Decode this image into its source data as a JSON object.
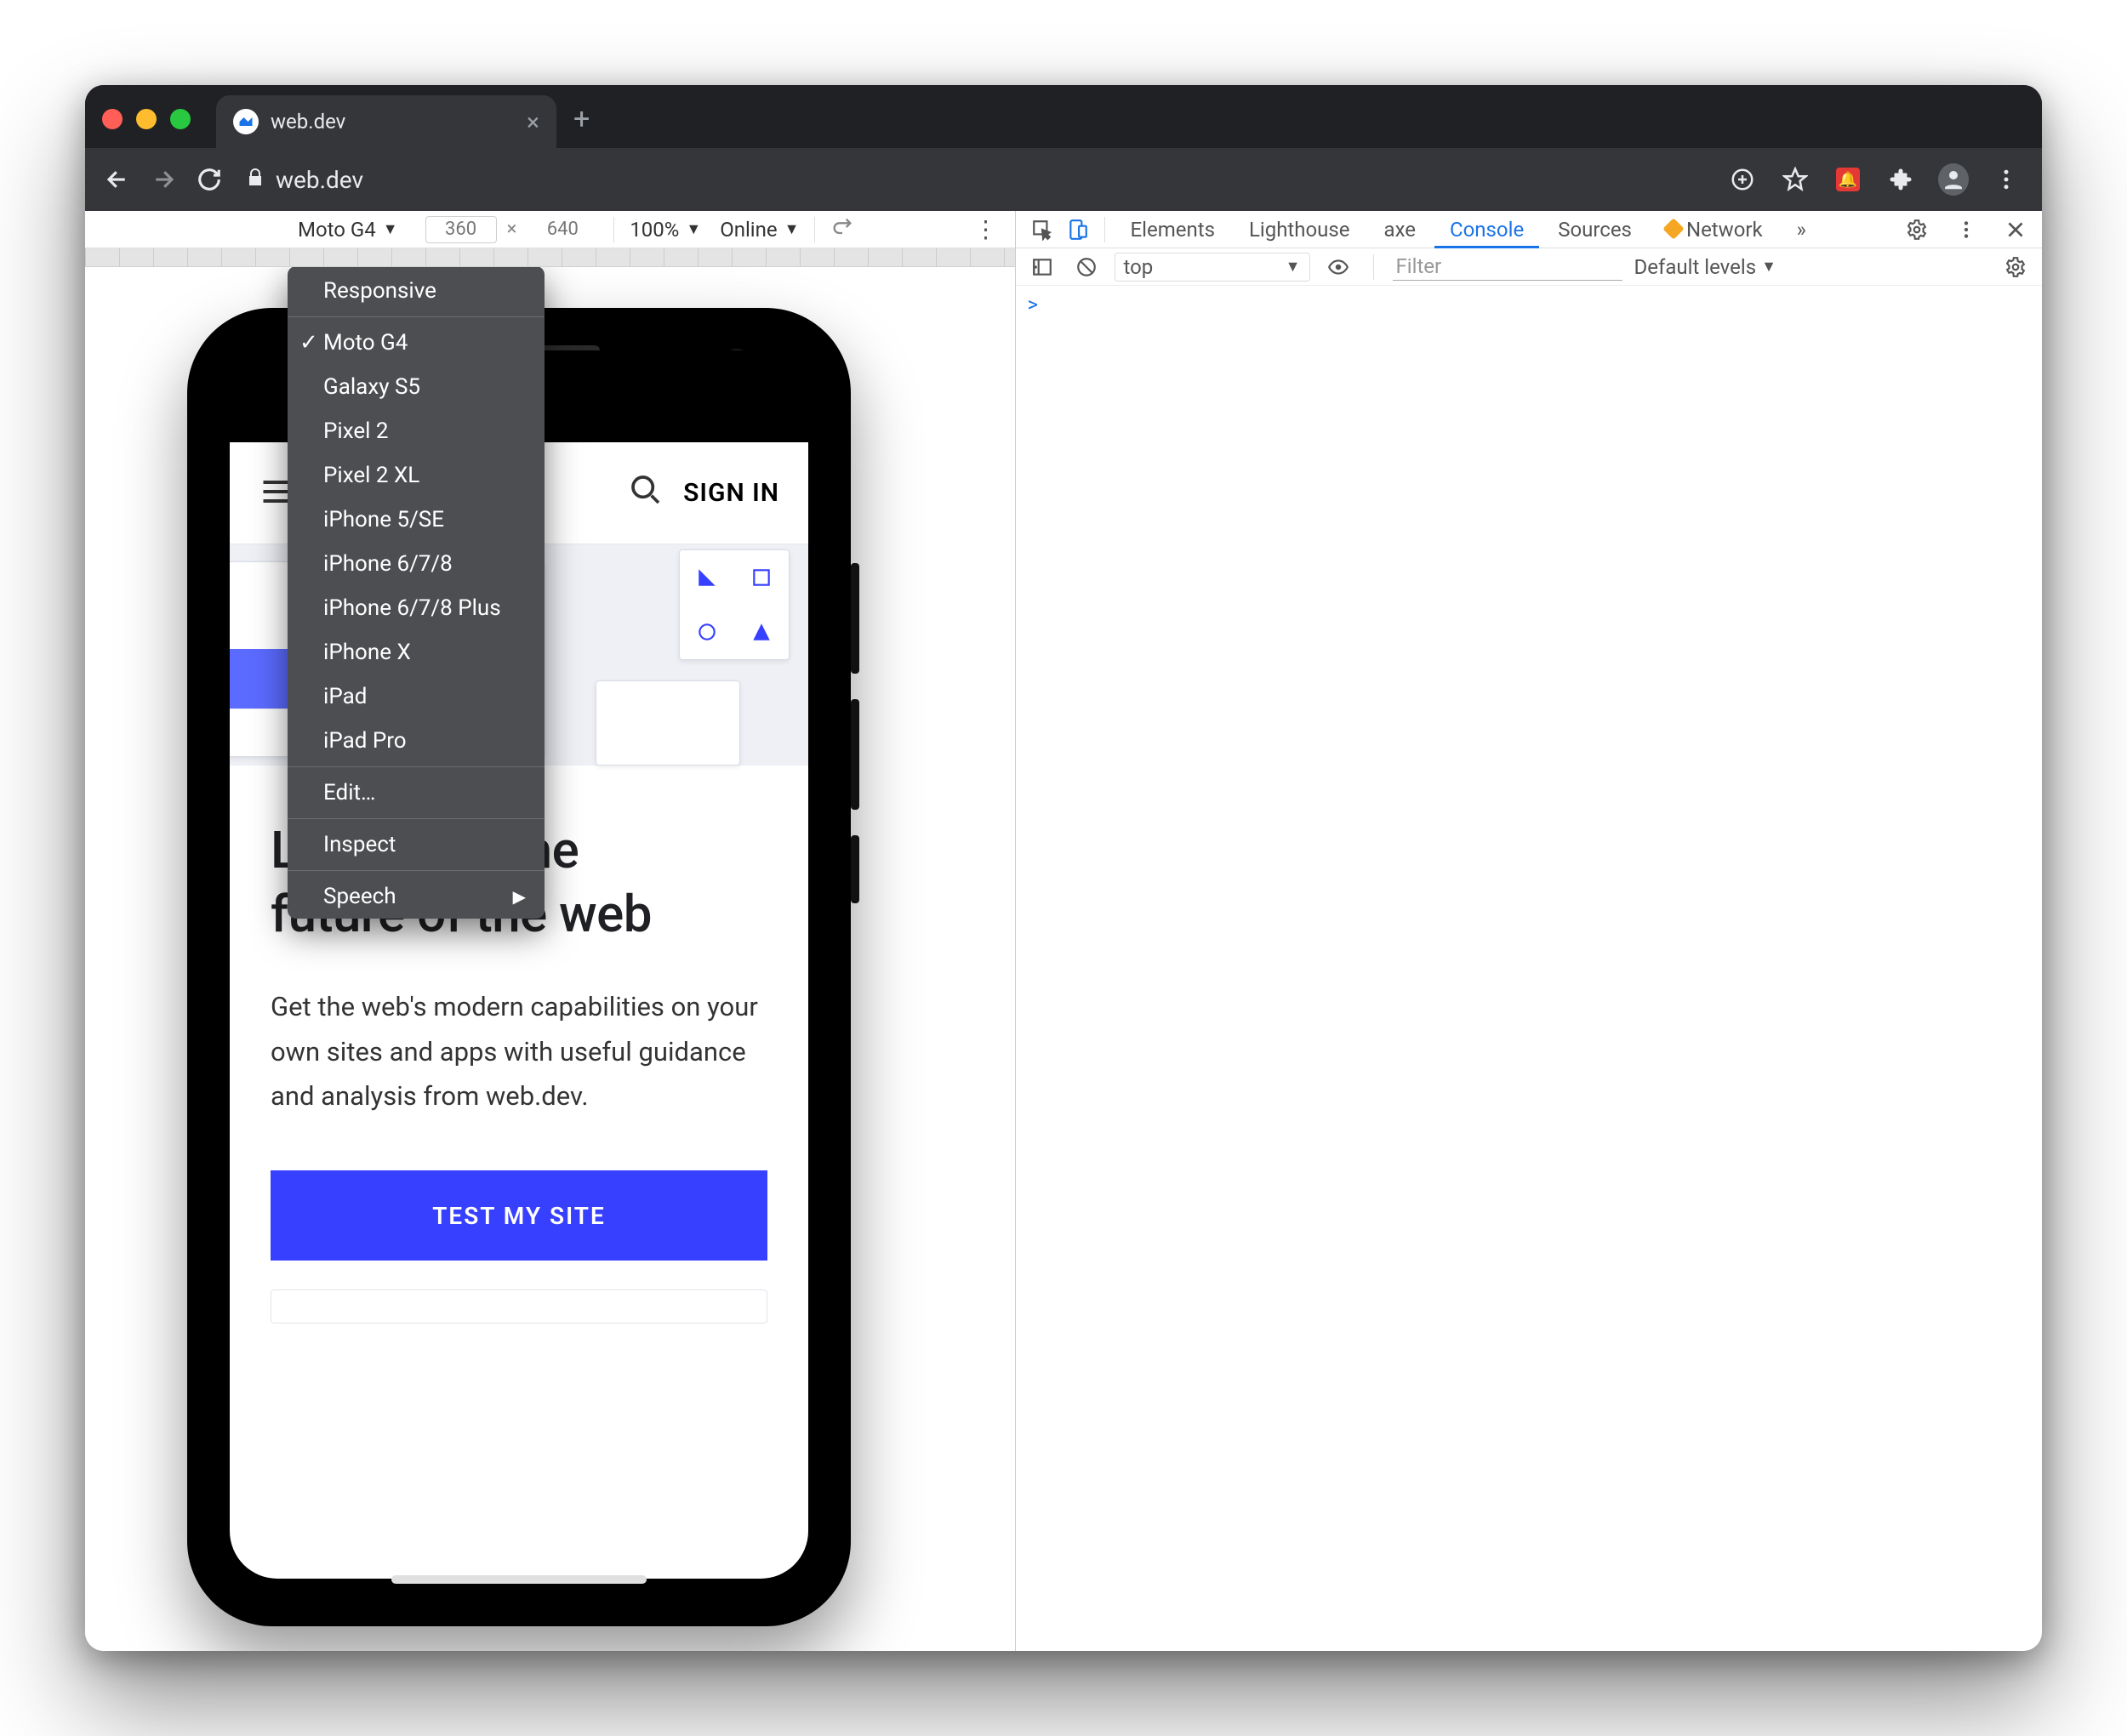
{
  "tab": {
    "title": "web.dev"
  },
  "url": {
    "text": "web.dev"
  },
  "deviceToolbar": {
    "device": "Moto G4",
    "width": "360",
    "height": "640",
    "zoom": "100%",
    "throttle": "Online"
  },
  "deviceDropdown": {
    "responsive": "Responsive",
    "devices": [
      "Moto G4",
      "Galaxy S5",
      "Pixel 2",
      "Pixel 2 XL",
      "iPhone 5/SE",
      "iPhone 6/7/8",
      "iPhone 6/7/8 Plus",
      "iPhone X",
      "iPad",
      "iPad Pro"
    ],
    "selected": "Moto G4",
    "edit": "Edit…",
    "inspect": "Inspect",
    "speech": "Speech"
  },
  "site": {
    "signIn": "SIGN IN",
    "heroTitle1": "Let's build the",
    "heroTitle2": "future of the web",
    "heroBody": "Get the web's modern capabilities on your own sites and apps with useful guidance and analysis from web.dev.",
    "cta": "TEST MY SITE"
  },
  "devtools": {
    "tabs": [
      "Elements",
      "Lighthouse",
      "axe",
      "Console",
      "Sources",
      "Network"
    ],
    "activeTab": "Console",
    "more": "»",
    "subbar": {
      "context": "top",
      "filterPlaceholder": "Filter",
      "levels": "Default levels"
    },
    "prompt": ">"
  }
}
